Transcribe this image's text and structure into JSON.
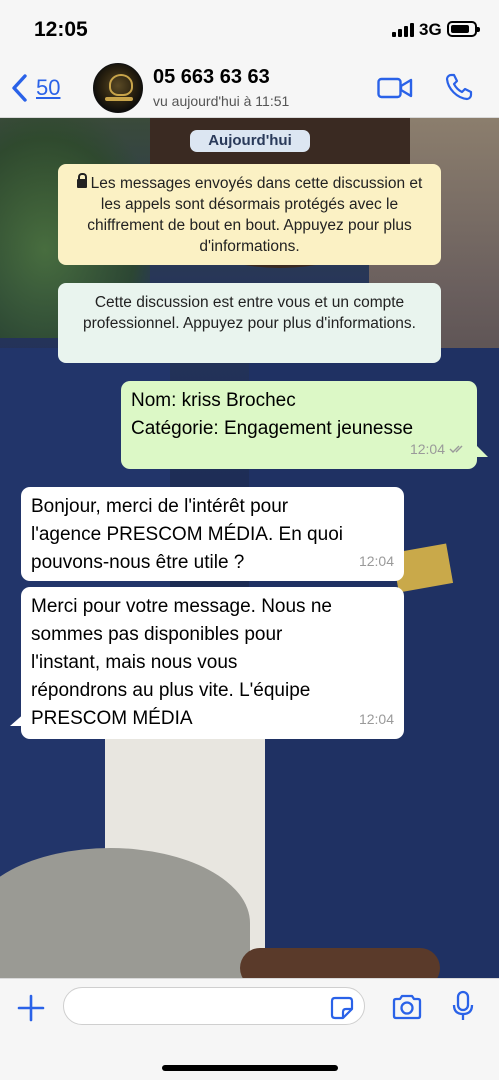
{
  "status_bar": {
    "time": "12:05",
    "network": "3G"
  },
  "header": {
    "back_count": "50",
    "contact_name": "05 663 63 63",
    "last_seen": "vu aujourd'hui à 11:51"
  },
  "chat": {
    "date_chip": "Aujourd'hui",
    "system_encryption": "Les messages envoyés dans cette discussion et les appels sont désormais protégés avec le chiffrement de bout en bout. Appuyez pour plus d'informations.",
    "system_business": "Cette discussion est entre vous et un compte professionnel. Appuyez pour plus d'informations.",
    "messages": [
      {
        "direction": "out",
        "lines": [
          "Nom: kriss Brochec",
          "Catégorie: Engagement jeunesse"
        ],
        "time": "12:04"
      },
      {
        "direction": "in",
        "lines": [
          "Bonjour, merci de l'intérêt pour",
          "l'agence PRESCOM MÉDIA. En quoi",
          "pouvons-nous être utile ?"
        ],
        "time": "12:04"
      },
      {
        "direction": "in",
        "lines": [
          "Merci pour votre message. Nous ne",
          "sommes pas disponibles pour",
          "l'instant, mais nous vous",
          "répondrons au plus vite. L'équipe",
          "PRESCOM MÉDIA"
        ],
        "time": "12:04"
      }
    ]
  },
  "colors": {
    "accent": "#2a62e8",
    "outgoing_bubble": "#dcf8c6",
    "incoming_bubble": "#ffffff"
  },
  "icons": [
    "chevron-left-icon",
    "video-call-icon",
    "phone-icon",
    "plus-icon",
    "sticker-icon",
    "camera-icon",
    "microphone-icon",
    "lock-icon",
    "double-check-icon"
  ]
}
